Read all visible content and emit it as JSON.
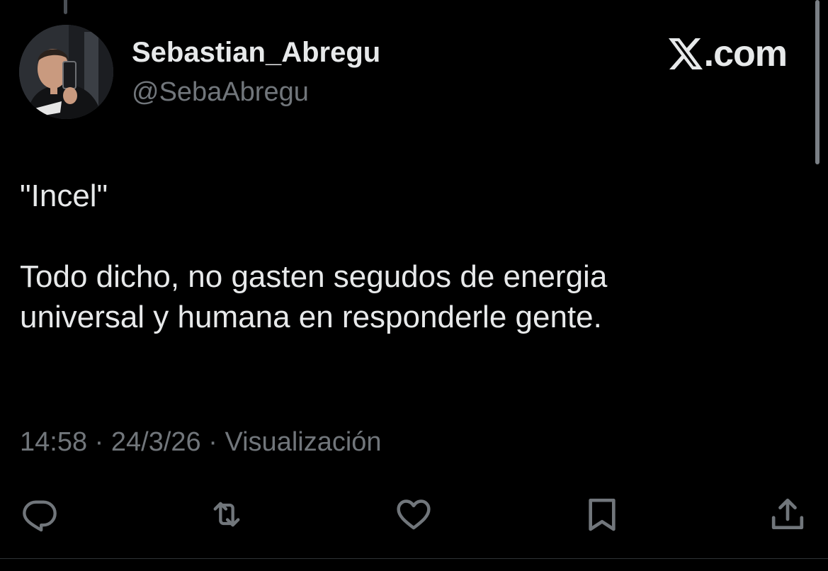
{
  "author": {
    "display_name": "Sebastian_Abregu",
    "handle": "@SebaAbregu",
    "avatar": "profile-photo"
  },
  "brand": {
    "label": ".com",
    "logo": "x-logo"
  },
  "tweet": {
    "text": "\"Incel\"\n\nTodo dicho, no gasten segudos de energia\nuniversal y humana en responderle gente.",
    "time": "14:58",
    "date": "24/3/26",
    "views_label": "Visualización",
    "separator": "·"
  },
  "actions": [
    {
      "name": "reply",
      "icon": "reply-icon"
    },
    {
      "name": "retweet",
      "icon": "retweet-icon"
    },
    {
      "name": "like",
      "icon": "heart-icon"
    },
    {
      "name": "bookmark",
      "icon": "bookmark-icon"
    },
    {
      "name": "share",
      "icon": "share-icon"
    }
  ],
  "colors": {
    "background": "#000000",
    "primary_text": "#e7e9ea",
    "secondary_text": "#71767b"
  }
}
